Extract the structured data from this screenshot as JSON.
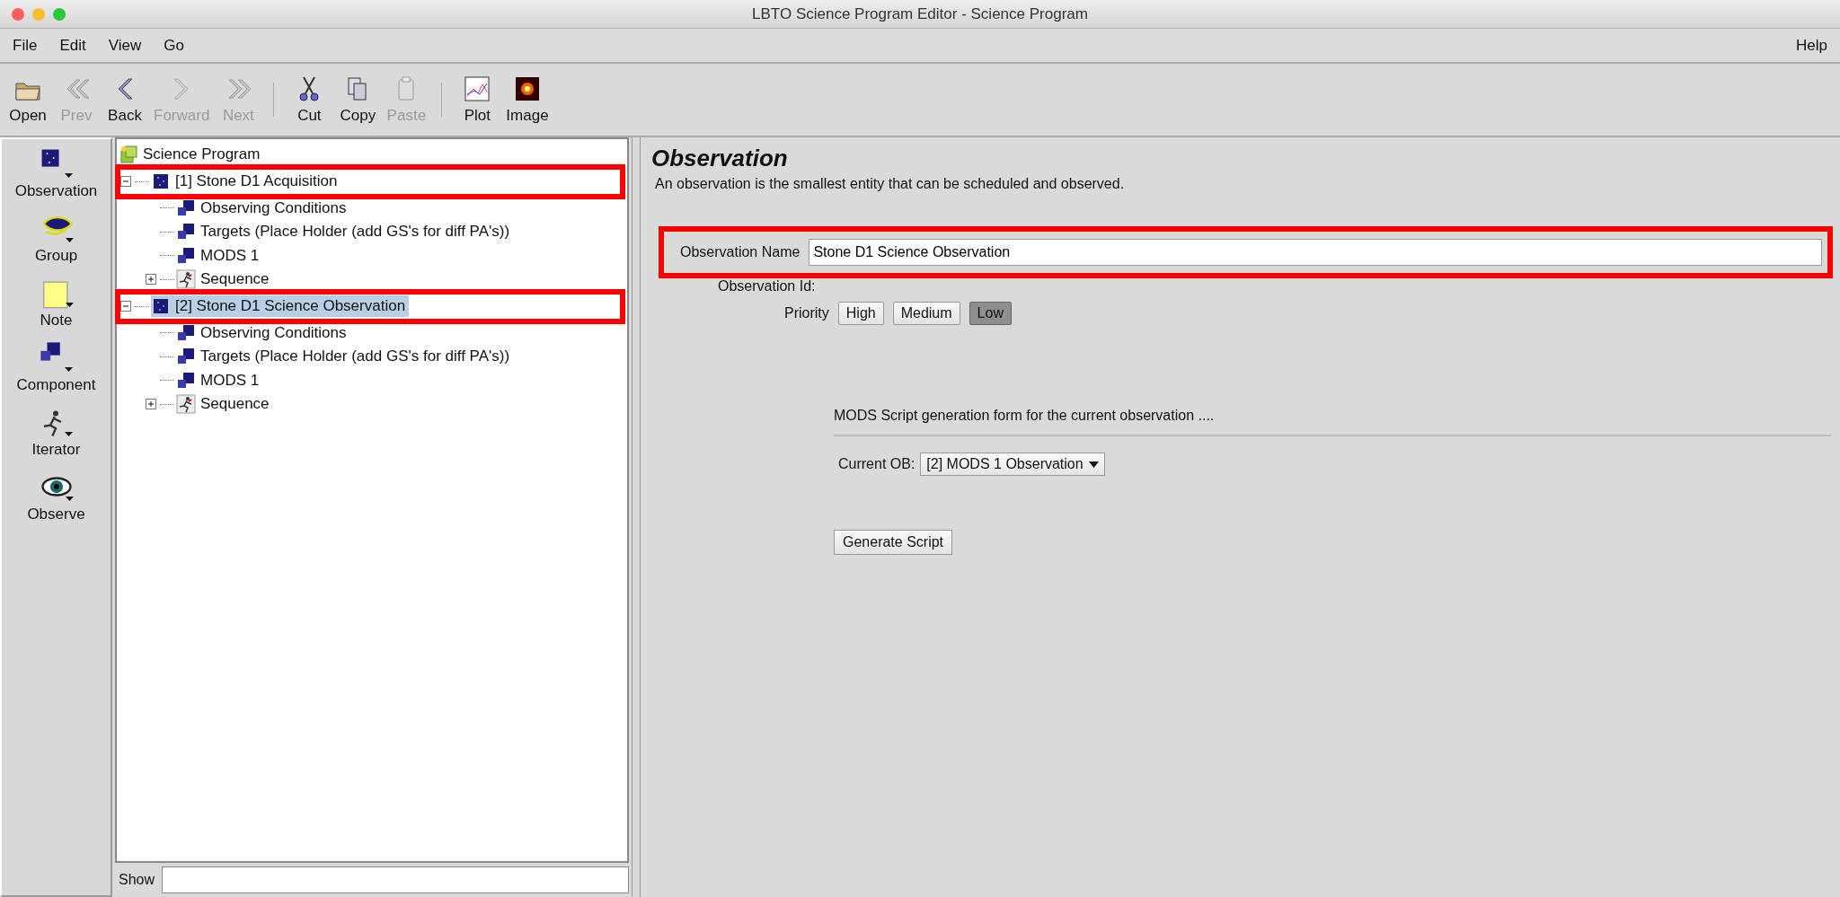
{
  "window": {
    "title": "LBTO Science Program Editor - Science Program"
  },
  "menu": {
    "items": [
      "File",
      "Edit",
      "View",
      "Go"
    ],
    "help": "Help"
  },
  "toolbar": {
    "groups": [
      [
        {
          "label": "Open",
          "kind": "folder",
          "disabled": false
        },
        {
          "label": "Prev",
          "kind": "double-left",
          "disabled": true
        },
        {
          "label": "Back",
          "kind": "left",
          "disabled": false
        },
        {
          "label": "Forward",
          "kind": "right",
          "disabled": true
        },
        {
          "label": "Next",
          "kind": "double-right",
          "disabled": true
        }
      ],
      [
        {
          "label": "Cut",
          "kind": "scissors",
          "disabled": false
        },
        {
          "label": "Copy",
          "kind": "copy",
          "disabled": false
        },
        {
          "label": "Paste",
          "kind": "clipboard",
          "disabled": true
        }
      ],
      [
        {
          "label": "Plot",
          "kind": "plot",
          "disabled": false
        },
        {
          "label": "Image",
          "kind": "image",
          "disabled": false
        }
      ]
    ]
  },
  "palette": [
    {
      "label": "Observation",
      "kind": "observation"
    },
    {
      "label": "Group",
      "kind": "group"
    },
    {
      "label": "Note",
      "kind": "note"
    },
    {
      "label": "Component",
      "kind": "component"
    },
    {
      "label": "Iterator",
      "kind": "iterator"
    },
    {
      "label": "Observe",
      "kind": "observe"
    }
  ],
  "tree": {
    "root": {
      "label": "Science Program",
      "kind": "program"
    },
    "children": [
      {
        "label": "[1] Stone D1 Acquisition",
        "kind": "observation",
        "expanded": true,
        "selected": false,
        "highlighted": true,
        "children": [
          {
            "label": "Observing Conditions",
            "kind": "component",
            "selected": false,
            "highlighted": false
          },
          {
            "label": "Targets (Place Holder (add GS's for diff PA's))",
            "kind": "component",
            "selected": false,
            "highlighted": false
          },
          {
            "label": "MODS 1",
            "kind": "component",
            "selected": false,
            "highlighted": false
          },
          {
            "label": "Sequence",
            "kind": "sequence",
            "expanded": false,
            "selected": false,
            "highlighted": false
          }
        ]
      },
      {
        "label": "[2] Stone D1 Science Observation",
        "kind": "observation",
        "expanded": true,
        "selected": true,
        "highlighted": true,
        "children": [
          {
            "label": "Observing Conditions",
            "kind": "component",
            "selected": false,
            "highlighted": false
          },
          {
            "label": "Targets (Place Holder (add GS's for diff PA's))",
            "kind": "component",
            "selected": false,
            "highlighted": false
          },
          {
            "label": "MODS 1",
            "kind": "component",
            "selected": false,
            "highlighted": false
          },
          {
            "label": "Sequence",
            "kind": "sequence",
            "expanded": false,
            "selected": false,
            "highlighted": false
          }
        ]
      }
    ]
  },
  "show": {
    "label": "Show"
  },
  "editor": {
    "title": "Observation",
    "description": "An observation is the smallest entity that can be scheduled and observed.",
    "name_label": "Observation Name",
    "name_value": "Stone D1 Science Observation",
    "name_highlighted": true,
    "id_label": "Observation Id:",
    "priority_label": "Priority",
    "priorities": [
      {
        "label": "High",
        "selected": false
      },
      {
        "label": "Medium",
        "selected": false
      },
      {
        "label": "Low",
        "selected": true
      }
    ],
    "script_heading": "MODS Script generation form for the current observation ....",
    "ob_label": "Current OB:",
    "ob_value": "[2] MODS 1 Observation",
    "generate_button": "Generate Script"
  }
}
